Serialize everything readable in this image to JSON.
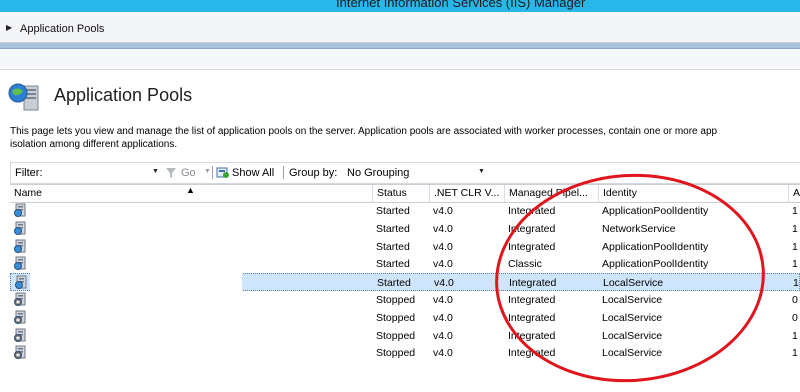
{
  "window": {
    "title": "Internet Information Services (IIS) Manager"
  },
  "breadcrumb": {
    "item": "Application Pools"
  },
  "page": {
    "title": "Application Pools",
    "description_line1": "This page lets you view and manage the list of application pools on the server. Application pools are associated with worker processes, contain one or more app",
    "description_line2": "isolation among different applications."
  },
  "filterbar": {
    "filter_label": "Filter:",
    "go_label": "Go",
    "show_all_label": "Show All",
    "group_by_label": "Group by:",
    "group_by_value": "No Grouping"
  },
  "table": {
    "columns": [
      "Name",
      "Status",
      ".NET CLR V...",
      "Managed Pipel...",
      "Identity",
      "A"
    ],
    "rows": [
      {
        "name": "",
        "status": "Started",
        "clr": "v4.0",
        "pipeline": "Integrated",
        "identity": "ApplicationPoolIdentity",
        "apps": "1",
        "started": true,
        "selected": false
      },
      {
        "name": "",
        "status": "Started",
        "clr": "v4.0",
        "pipeline": "Integrated",
        "identity": "NetworkService",
        "apps": "1",
        "started": true,
        "selected": false
      },
      {
        "name": "",
        "status": "Started",
        "clr": "v4.0",
        "pipeline": "Integrated",
        "identity": "ApplicationPoolIdentity",
        "apps": "1",
        "started": true,
        "selected": false
      },
      {
        "name": "",
        "status": "Started",
        "clr": "v4.0",
        "pipeline": "Classic",
        "identity": "ApplicationPoolIdentity",
        "apps": "1",
        "started": true,
        "selected": false
      },
      {
        "name": "",
        "status": "Started",
        "clr": "v4.0",
        "pipeline": "Integrated",
        "identity": "LocalService",
        "apps": "1",
        "started": true,
        "selected": true
      },
      {
        "name": "",
        "status": "Stopped",
        "clr": "v4.0",
        "pipeline": "Integrated",
        "identity": "LocalService",
        "apps": "0",
        "started": false,
        "selected": false
      },
      {
        "name": "",
        "status": "Stopped",
        "clr": "v4.0",
        "pipeline": "Integrated",
        "identity": "LocalService",
        "apps": "0",
        "started": false,
        "selected": false
      },
      {
        "name": "",
        "status": "Stopped",
        "clr": "v4.0",
        "pipeline": "Integrated",
        "identity": "LocalService",
        "apps": "1",
        "started": false,
        "selected": false
      },
      {
        "name": "",
        "status": "Stopped",
        "clr": "v4.0",
        "pipeline": "Integrated",
        "identity": "LocalService",
        "apps": "1",
        "started": false,
        "selected": false
      }
    ]
  },
  "colors": {
    "titlebar": "#29b6e8",
    "selection": "#cfe5fb",
    "annotation": "#e0151d"
  },
  "icons": {
    "page": "app-pools-icon",
    "row": "app-pool-icon",
    "go": "funnel-icon",
    "show_all": "show-all-icon"
  }
}
